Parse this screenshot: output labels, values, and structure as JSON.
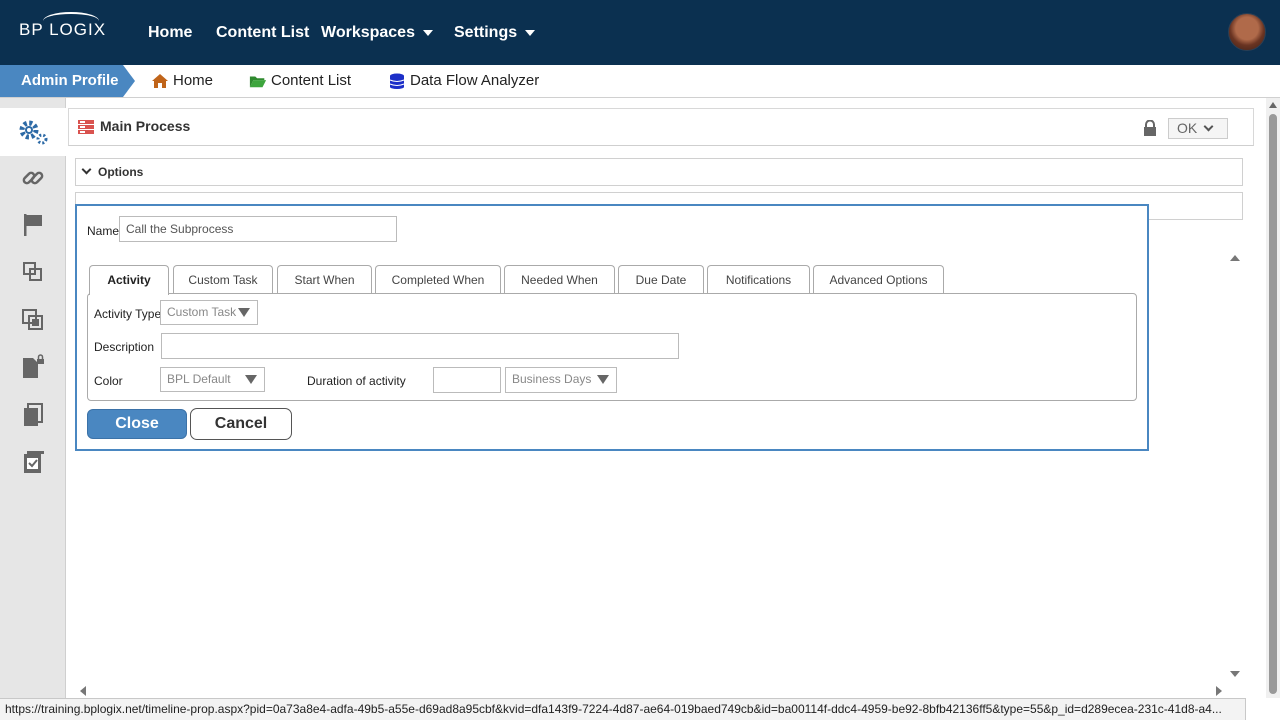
{
  "app": {
    "logo_text": "BP LOGIX"
  },
  "topnav": {
    "items": [
      {
        "label": "Home"
      },
      {
        "label": "Content List"
      },
      {
        "label": "Workspaces"
      },
      {
        "label": "Settings"
      }
    ]
  },
  "breadcrumb": {
    "profile": "Admin Profile",
    "items": [
      {
        "label": "Home",
        "icon": "home-icon"
      },
      {
        "label": "Content List",
        "icon": "folder-icon"
      },
      {
        "label": "Data Flow Analyzer",
        "icon": "database-icon"
      }
    ]
  },
  "sidebar": {
    "items": [
      {
        "icon": "gears-icon",
        "active": true
      },
      {
        "icon": "link-icon"
      },
      {
        "icon": "flag-icon"
      },
      {
        "icon": "nested-squares-icon"
      },
      {
        "icon": "overlap-squares-icon"
      },
      {
        "icon": "locked-document-icon"
      },
      {
        "icon": "documents-stack-icon"
      },
      {
        "icon": "checkbox-document-icon"
      }
    ]
  },
  "process": {
    "title": "Main Process",
    "ok_label": "OK",
    "options_label": "Options"
  },
  "dialog": {
    "name_label": "Name",
    "name_value": "Call the Subprocess",
    "tabs": [
      {
        "label": "Activity",
        "active": true
      },
      {
        "label": "Custom Task"
      },
      {
        "label": "Start When"
      },
      {
        "label": "Completed When"
      },
      {
        "label": "Needed When"
      },
      {
        "label": "Due Date"
      },
      {
        "label": "Notifications"
      },
      {
        "label": "Advanced Options"
      }
    ],
    "activity_type_label": "Activity Type",
    "activity_type_value": "Custom Task",
    "description_label": "Description",
    "description_value": "",
    "color_label": "Color",
    "color_value": "BPL Default",
    "duration_label": "Duration of activity",
    "duration_value": "",
    "duration_unit": "Business Days",
    "close_label": "Close",
    "cancel_label": "Cancel"
  },
  "statusbar": {
    "url": "https://training.bplogix.net/timeline-prop.aspx?pid=0a73a8e4-adfa-49b5-a55e-d69ad8a95cbf&kvid=dfa143f9-7224-4d87-ae64-019baed749cb&id=ba00114f-ddc4-4959-be92-8bfb42136ff5&type=55&p_id=d289ecea-231c-41d8-a4..."
  },
  "colors": {
    "nav_bg": "#0b3050",
    "accent": "#4a87c1"
  }
}
